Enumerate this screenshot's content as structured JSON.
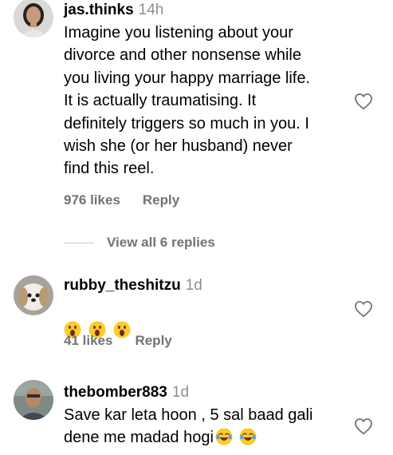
{
  "comments": [
    {
      "username": "jas.thinks",
      "time": "14h",
      "text": "Imagine you listening about your\ndivorce and other nonsense while\nyou living your happy marriage life.\nIt is actually traumatising. It\ndefinitely triggers so much in you. I\nwish she (or her husband) never\nfind this reel.",
      "likes": "976 likes",
      "reply_label": "Reply",
      "view_replies": "View all 6 replies"
    },
    {
      "username": "rubby_theshitzu",
      "time": "1d",
      "emojis": [
        "face-with-open-mouth",
        "face-with-open-mouth",
        "face-with-open-mouth"
      ],
      "likes": "41 likes",
      "reply_label": "Reply"
    },
    {
      "username": "thebomber883",
      "time": "1d",
      "text_line1": "Save kar leta hoon , 5 sal baad gali",
      "text_line2": "dene me madad hogi",
      "emojis": [
        "face-with-tears-of-joy",
        "face-with-tears-of-joy"
      ]
    }
  ],
  "icons": {
    "like": "heart-outline-icon"
  },
  "colors": {
    "secondary_text": "#737373",
    "timestamp": "#8e8e8e"
  }
}
